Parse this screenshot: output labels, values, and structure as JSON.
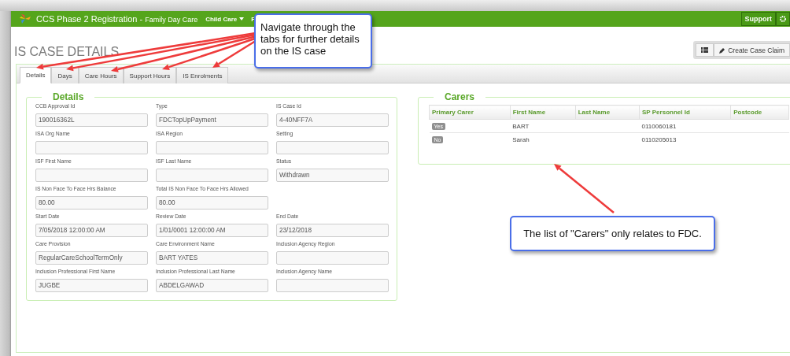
{
  "header": {
    "title": "CCS Phase 2 Registration -",
    "subtitle": "Family Day Care",
    "nav": [
      {
        "label": "Child Care"
      },
      {
        "label": "F"
      }
    ],
    "support": "Support"
  },
  "page_title": "IS CASE DETAILS",
  "toolbar": {
    "create": "Create Case Claim"
  },
  "tabs": [
    {
      "label": "Details",
      "selected": true
    },
    {
      "label": "Days",
      "selected": false
    },
    {
      "label": "Care Hours",
      "selected": false
    },
    {
      "label": "Support Hours",
      "selected": false
    },
    {
      "label": "IS Enrolments",
      "selected": false
    }
  ],
  "details": {
    "legend": "Details",
    "rows": [
      [
        {
          "label": "CCB Approval Id",
          "value": "190016362L"
        },
        {
          "label": "Type",
          "value": "FDCTopUpPayment"
        },
        {
          "label": "IS Case Id",
          "value": "4-40NFF7A"
        }
      ],
      [
        {
          "label": "ISA Org Name"
        },
        {
          "label": "ISA Region"
        },
        {
          "label": "Setting"
        }
      ],
      [
        {
          "label": "ISF First Name"
        },
        {
          "label": "ISF Last Name"
        },
        {
          "label": "Status",
          "value": "Withdrawn"
        }
      ],
      [
        {
          "label": "IS Non Face To Face Hrs Balance",
          "value": "80.00"
        },
        {
          "label": "Total IS Non Face To Face Hrs Allowed",
          "value": "80.00"
        }
      ],
      [
        {
          "label": "Start Date",
          "value": "7/05/2018 12:00:00 AM"
        },
        {
          "label": "Review Date",
          "value": "1/01/0001 12:00:00 AM"
        },
        {
          "label": "End Date",
          "value": "23/12/2018"
        }
      ],
      [
        {
          "label": "Care Provision",
          "value": "RegularCareSchoolTermOnly"
        },
        {
          "label": "Care Environment Name",
          "value": "BART YATES"
        },
        {
          "label": "Inclusion Agency Region"
        }
      ],
      [
        {
          "label": "Inclusion Professional First Name",
          "value": "JUGBE"
        },
        {
          "label": "Inclusion Professional Last Name",
          "value": "ABDELGAWAD"
        },
        {
          "label": "Inclusion Agency Name"
        }
      ]
    ]
  },
  "carers": {
    "legend": "Carers",
    "columns": [
      "Primary Carer",
      "First Name",
      "Last Name",
      "SP Personnel Id",
      "Postcode"
    ],
    "rows": [
      {
        "primary": "Yes",
        "first_name": "BART",
        "personnel_id": "0110060181"
      },
      {
        "primary": "No",
        "first_name": "Sarah",
        "personnel_id": "0110205013"
      }
    ]
  },
  "callouts": [
    {
      "text": "Navigate through the tabs for further details on the IS case"
    },
    {
      "text": "The list of \"Carers\" only relates to FDC."
    }
  ]
}
